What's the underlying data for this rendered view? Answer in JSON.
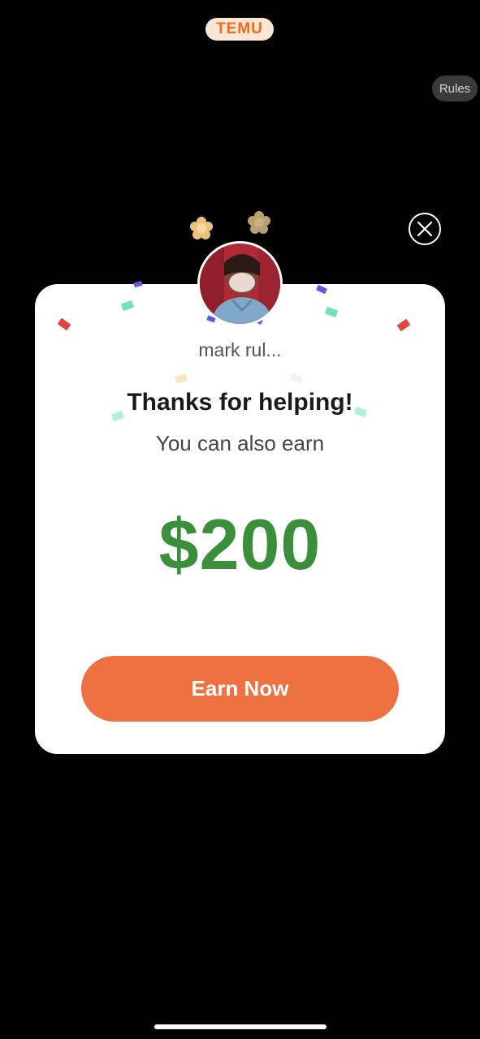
{
  "header": {
    "brand": "TEMU",
    "rules_label": "Rules"
  },
  "popup": {
    "username": "mark rul...",
    "title": "Thanks for helping!",
    "subtitle": "You can also earn",
    "amount": "$200",
    "cta_label": "Earn Now"
  },
  "colors": {
    "background": "#000000",
    "brand": "#f26a1b",
    "amount": "#3c8f3a",
    "cta": "#ee7142"
  },
  "icons": [
    "close-icon",
    "flower-icon",
    "avatar"
  ]
}
